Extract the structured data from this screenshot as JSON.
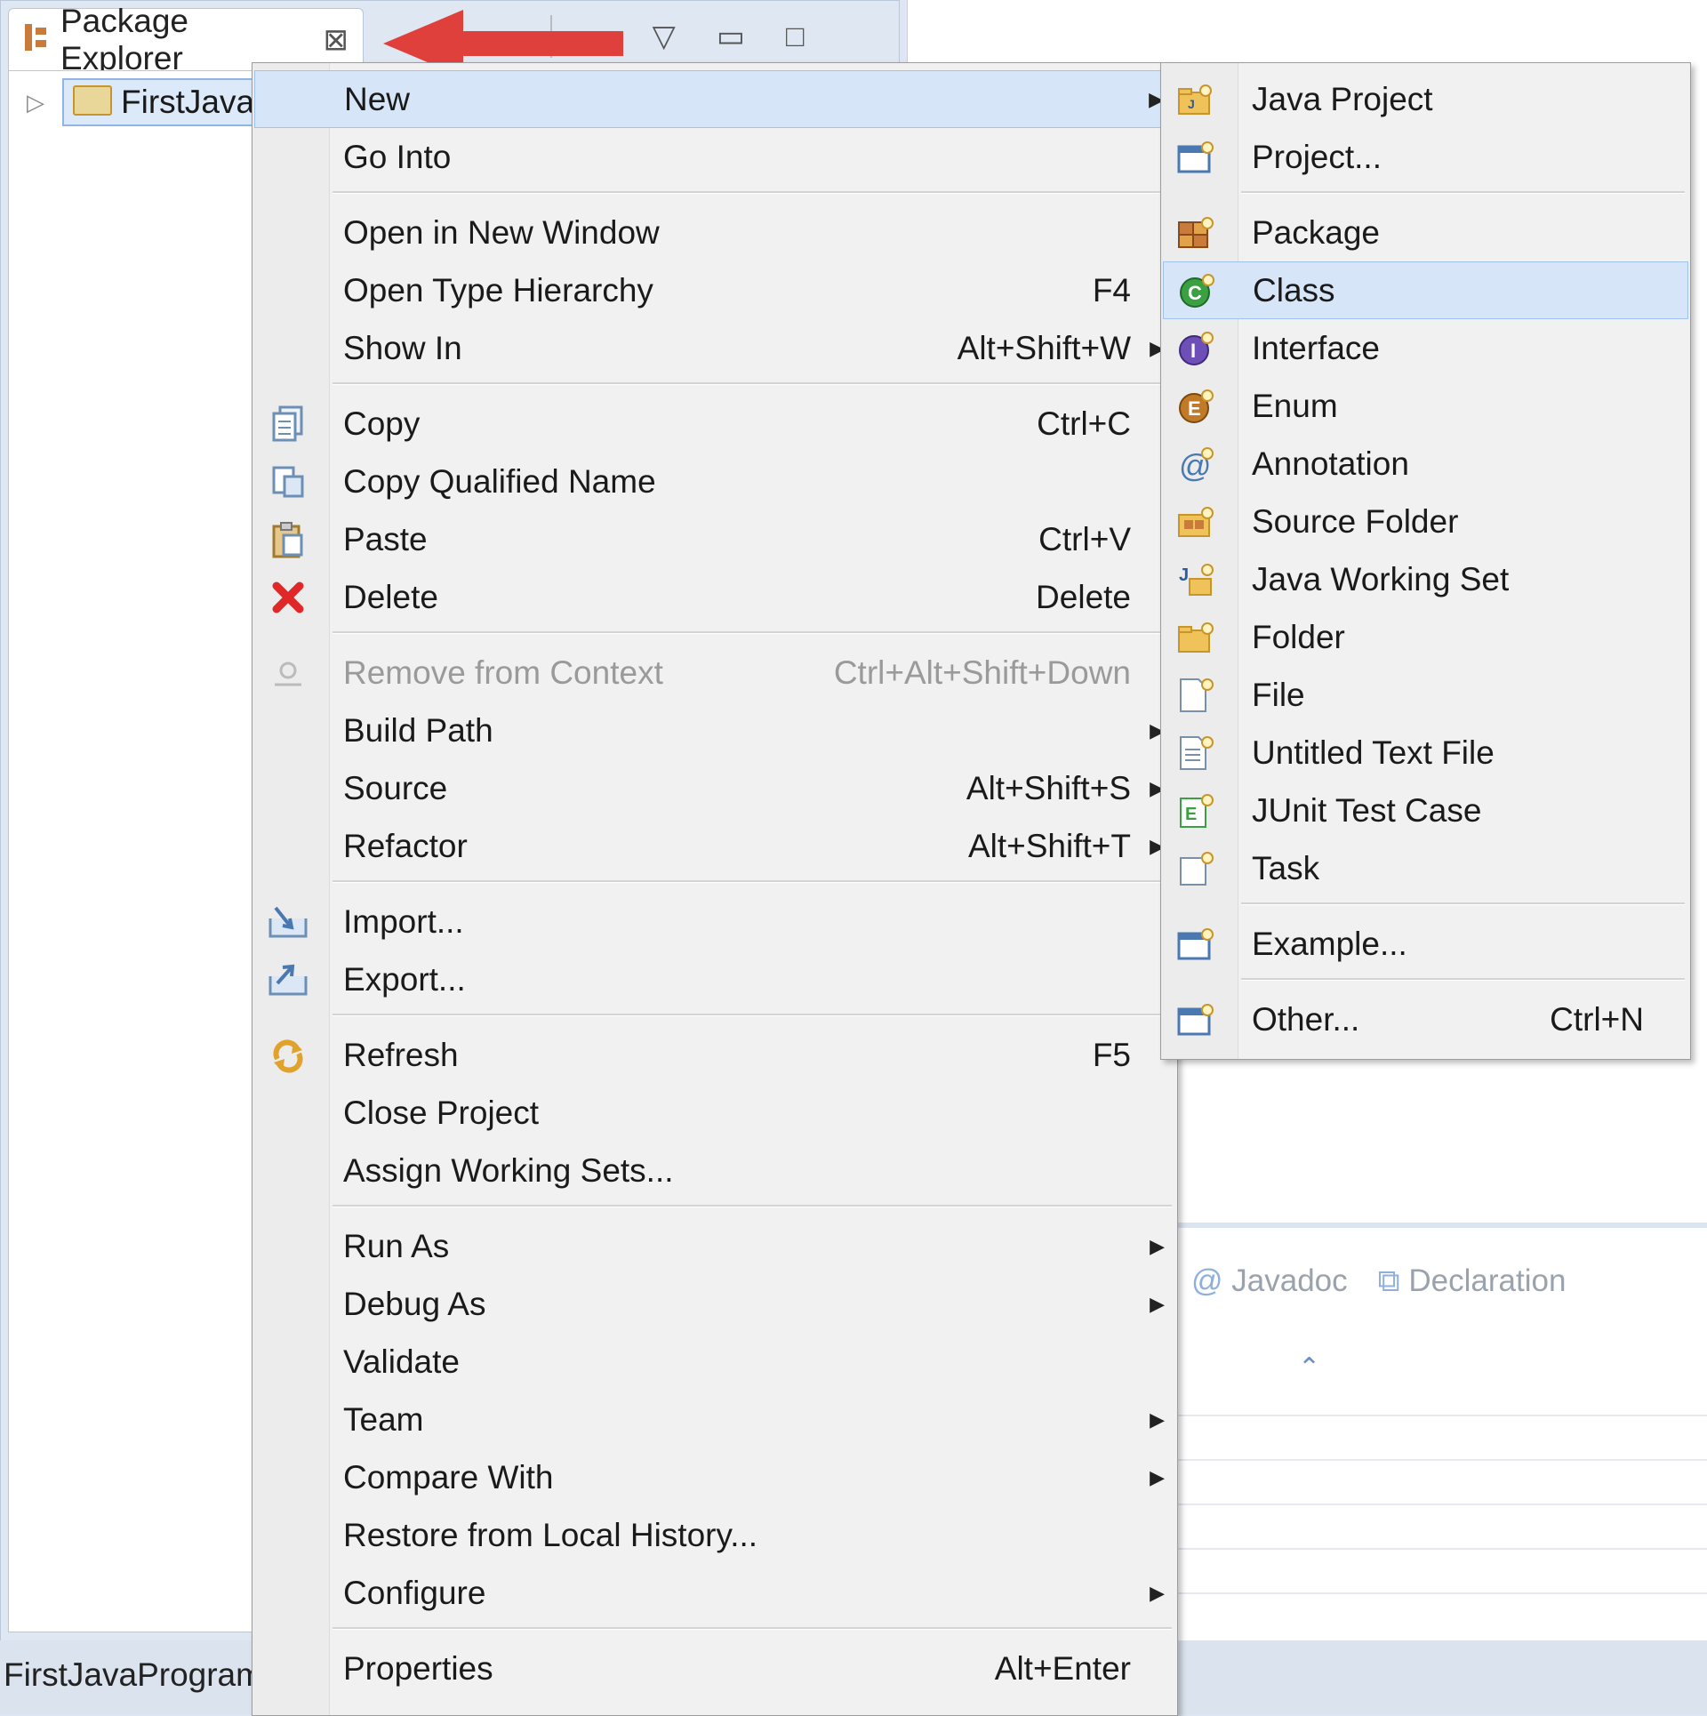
{
  "package_explorer": {
    "tab_title": "Package Explorer",
    "project_label": "FirstJavaP",
    "status_text": "FirstJavaProgram"
  },
  "lower_panel": {
    "tabs": [
      {
        "label": "Javadoc"
      },
      {
        "label": "Declaration"
      }
    ]
  },
  "main_menu": [
    {
      "type": "item",
      "label": "New",
      "shortcut": "",
      "submenu": true,
      "highlight": true,
      "icon": "none"
    },
    {
      "type": "item",
      "label": "Go Into",
      "shortcut": "",
      "icon": "none"
    },
    {
      "type": "sep"
    },
    {
      "type": "item",
      "label": "Open in New Window",
      "shortcut": "",
      "icon": "none"
    },
    {
      "type": "item",
      "label": "Open Type Hierarchy",
      "shortcut": "F4",
      "icon": "none"
    },
    {
      "type": "item",
      "label": "Show In",
      "shortcut": "Alt+Shift+W",
      "submenu": true,
      "icon": "none"
    },
    {
      "type": "sep"
    },
    {
      "type": "item",
      "label": "Copy",
      "shortcut": "Ctrl+C",
      "icon": "copy-icon"
    },
    {
      "type": "item",
      "label": "Copy Qualified Name",
      "shortcut": "",
      "icon": "copy-qualified-name-icon"
    },
    {
      "type": "item",
      "label": "Paste",
      "shortcut": "Ctrl+V",
      "icon": "paste-icon"
    },
    {
      "type": "item",
      "label": "Delete",
      "shortcut": "Delete",
      "icon": "delete-icon"
    },
    {
      "type": "sep"
    },
    {
      "type": "item",
      "label": "Remove from Context",
      "shortcut": "Ctrl+Alt+Shift+Down",
      "disabled": true,
      "icon": "remove-context-icon"
    },
    {
      "type": "item",
      "label": "Build Path",
      "shortcut": "",
      "submenu": true,
      "icon": "none"
    },
    {
      "type": "item",
      "label": "Source",
      "shortcut": "Alt+Shift+S",
      "submenu": true,
      "icon": "none"
    },
    {
      "type": "item",
      "label": "Refactor",
      "shortcut": "Alt+Shift+T",
      "submenu": true,
      "icon": "none"
    },
    {
      "type": "sep"
    },
    {
      "type": "item",
      "label": "Import...",
      "shortcut": "",
      "icon": "import-icon"
    },
    {
      "type": "item",
      "label": "Export...",
      "shortcut": "",
      "icon": "export-icon"
    },
    {
      "type": "sep"
    },
    {
      "type": "item",
      "label": "Refresh",
      "shortcut": "F5",
      "icon": "refresh-icon"
    },
    {
      "type": "item",
      "label": "Close Project",
      "shortcut": "",
      "icon": "none"
    },
    {
      "type": "item",
      "label": "Assign Working Sets...",
      "shortcut": "",
      "icon": "none"
    },
    {
      "type": "sep"
    },
    {
      "type": "item",
      "label": "Run As",
      "shortcut": "",
      "submenu": true,
      "icon": "none"
    },
    {
      "type": "item",
      "label": "Debug As",
      "shortcut": "",
      "submenu": true,
      "icon": "none"
    },
    {
      "type": "item",
      "label": "Validate",
      "shortcut": "",
      "icon": "none"
    },
    {
      "type": "item",
      "label": "Team",
      "shortcut": "",
      "submenu": true,
      "icon": "none"
    },
    {
      "type": "item",
      "label": "Compare With",
      "shortcut": "",
      "submenu": true,
      "icon": "none"
    },
    {
      "type": "item",
      "label": "Restore from Local History...",
      "shortcut": "",
      "icon": "none"
    },
    {
      "type": "item",
      "label": "Configure",
      "shortcut": "",
      "submenu": true,
      "icon": "none"
    },
    {
      "type": "sep"
    },
    {
      "type": "item",
      "label": "Properties",
      "shortcut": "Alt+Enter",
      "icon": "none"
    }
  ],
  "sub_menu": [
    {
      "type": "item",
      "label": "Java Project",
      "shortcut": "",
      "icon": "java-project-icon"
    },
    {
      "type": "item",
      "label": "Project...",
      "shortcut": "",
      "icon": "project-icon"
    },
    {
      "type": "sep"
    },
    {
      "type": "item",
      "label": "Package",
      "shortcut": "",
      "icon": "package-icon"
    },
    {
      "type": "item",
      "label": "Class",
      "shortcut": "",
      "highlight": true,
      "icon": "class-icon"
    },
    {
      "type": "item",
      "label": "Interface",
      "shortcut": "",
      "icon": "interface-icon"
    },
    {
      "type": "item",
      "label": "Enum",
      "shortcut": "",
      "icon": "enum-icon"
    },
    {
      "type": "item",
      "label": "Annotation",
      "shortcut": "",
      "icon": "annotation-icon"
    },
    {
      "type": "item",
      "label": "Source Folder",
      "shortcut": "",
      "icon": "source-folder-icon"
    },
    {
      "type": "item",
      "label": "Java Working Set",
      "shortcut": "",
      "icon": "java-working-set-icon"
    },
    {
      "type": "item",
      "label": "Folder",
      "shortcut": "",
      "icon": "folder-icon"
    },
    {
      "type": "item",
      "label": "File",
      "shortcut": "",
      "icon": "file-icon"
    },
    {
      "type": "item",
      "label": "Untitled Text File",
      "shortcut": "",
      "icon": "untitled-text-file-icon"
    },
    {
      "type": "item",
      "label": "JUnit Test Case",
      "shortcut": "",
      "icon": "junit-test-case-icon"
    },
    {
      "type": "item",
      "label": "Task",
      "shortcut": "",
      "icon": "task-icon"
    },
    {
      "type": "sep"
    },
    {
      "type": "item",
      "label": "Example...",
      "shortcut": "",
      "icon": "example-icon"
    },
    {
      "type": "sep"
    },
    {
      "type": "item",
      "label": "Other...",
      "shortcut": "Ctrl+N",
      "icon": "other-icon"
    }
  ],
  "colors": {
    "highlight": "#d6e6f8",
    "arrow": "#e0403c",
    "class_icon": "#3aa042",
    "interface_icon": "#6e4fb8",
    "enum_icon": "#c07a28",
    "delete_icon": "#e02828"
  }
}
